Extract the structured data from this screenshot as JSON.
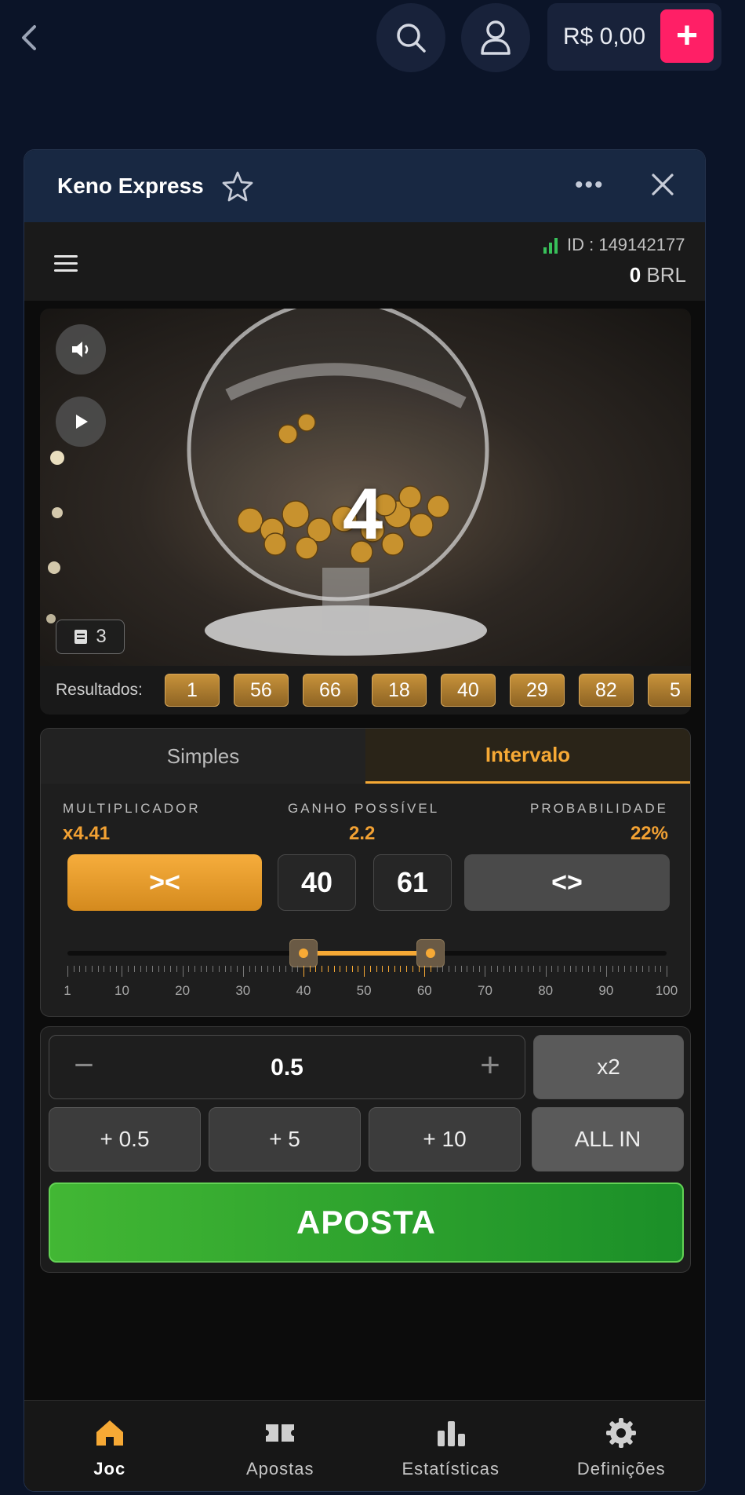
{
  "topbar": {
    "balance": "R$ 0,00",
    "deposit_label": "+"
  },
  "game": {
    "title": "Keno Express",
    "menu_dots": "•••",
    "id_text": "ID : 149142177",
    "balance_amount": "0",
    "balance_currency": "BRL"
  },
  "video": {
    "drawn_number": "4",
    "draw_counter": "3"
  },
  "results": {
    "label": "Resultados:",
    "numbers": [
      "1",
      "56",
      "66",
      "18",
      "40",
      "29",
      "82",
      "5"
    ]
  },
  "interval": {
    "tabs": [
      {
        "label": "Simples",
        "active": false
      },
      {
        "label": "Intervalo",
        "active": true
      }
    ],
    "multiplier_label": "MULTIPLICADOR",
    "multiplier_value": "x4.41",
    "gain_label": "GANHO POSSÍVEL",
    "gain_value": "2.2",
    "probability_label": "PROBABILIDADE",
    "probability_value": "22%",
    "narrow_label": "><",
    "wide_label": "<>",
    "range_min": "40",
    "range_max": "61",
    "slider": {
      "min": 1,
      "max": 100,
      "low": 40,
      "high": 61,
      "tick_labels": [
        "1",
        "10",
        "20",
        "30",
        "40",
        "50",
        "60",
        "70",
        "80",
        "90",
        "100"
      ]
    }
  },
  "bet": {
    "stake": "0.5",
    "minus_label": "−",
    "plus_label": "+",
    "double_label": "x2",
    "quick_amounts": [
      "+ 0.5",
      "+ 5",
      "+ 10"
    ],
    "all_in_label": "ALL IN",
    "bet_label": "APOSTA"
  },
  "nav": {
    "items": [
      {
        "label": "Joc",
        "icon": "home-icon",
        "active": true
      },
      {
        "label": "Apostas",
        "icon": "ticket-icon",
        "active": false
      },
      {
        "label": "Estatísticas",
        "icon": "bar-chart-icon",
        "active": false
      },
      {
        "label": "Definições",
        "icon": "gear-icon",
        "active": false
      }
    ]
  },
  "colors": {
    "accent": "#f6a935",
    "deposit": "#ff1f66",
    "bet_button": "#2ea52e",
    "background": "#0b1428"
  }
}
